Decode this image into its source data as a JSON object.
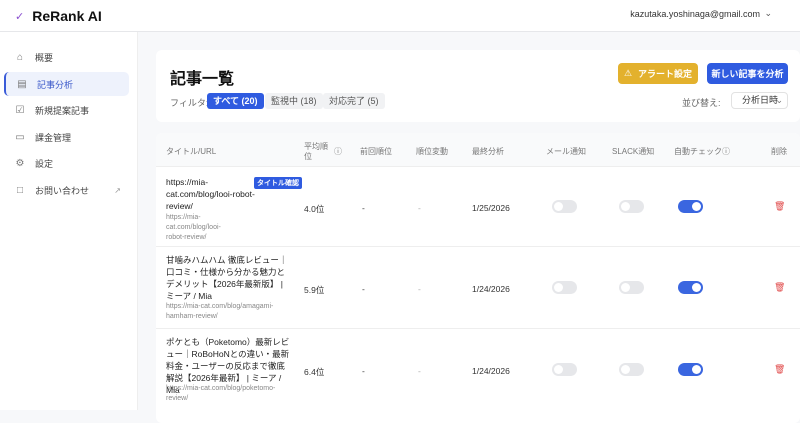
{
  "header": {
    "app_name": "ReRank AI",
    "user_email": "kazutaka.yoshinaga@gmail.com"
  },
  "sidebar": {
    "items": [
      {
        "label": "概要",
        "icon": "home-icon"
      },
      {
        "label": "記事分析",
        "icon": "document-icon",
        "active": true
      },
      {
        "label": "新規提案記事",
        "icon": "clipboard-icon"
      },
      {
        "label": "課金管理",
        "icon": "credit-card-icon"
      },
      {
        "label": "設定",
        "icon": "gear-icon"
      },
      {
        "label": "お問い合わせ",
        "icon": "chat-icon",
        "external": true
      }
    ]
  },
  "page": {
    "title": "記事一覧",
    "filter_label": "フィルタ:",
    "filters": [
      {
        "label": "すべて (20)",
        "active": true
      },
      {
        "label": "監視中 (18)"
      },
      {
        "label": "対応完了 (5)"
      }
    ],
    "alert_button": "アラート設定",
    "new_button": "新しい記事を分析",
    "sort_label": "並び替え:",
    "sort_value": "分析日時"
  },
  "table": {
    "headers": {
      "title": "タイトル/URL",
      "avg_rank": "平均順",
      "avg_rank2": "位",
      "prev": "前回順位",
      "change": "順位変動",
      "last": "最終分析",
      "mail": "メール通知",
      "slack": "SLACK通知",
      "auto": "自動チェック",
      "delete": "削除"
    },
    "rows": [
      {
        "title": "https://mia-cat.com/blog/looi-robot-review/",
        "badge": "タイトル確認",
        "url": "https://mia-cat.com/blog/looi-robot-review/",
        "avg": "4.0位",
        "prev": "-",
        "change": "-",
        "last": "1/25/2026",
        "mail": false,
        "slack": false,
        "auto": true
      },
      {
        "title": "甘噛みハムハム 徹底レビュー｜口コミ・仕様から分かる魅力とデメリット【2026年最新版】 | ミーア / Mia",
        "url": "https://mia-cat.com/blog/amagami-hamham-review/",
        "avg": "5.9位",
        "prev": "-",
        "change": "-",
        "last": "1/24/2026",
        "mail": false,
        "slack": false,
        "auto": true
      },
      {
        "title": "ポケとも（Poketomo）最新レビュー｜RoBoHoNとの違い・最新料金・ユーザーの反応まで徹底解説【2026年最新】 | ミーア / Mia",
        "url": "https://mia-cat.com/blog/poketomo-review/",
        "avg": "6.4位",
        "prev": "-",
        "change": "-",
        "last": "1/24/2026",
        "mail": false,
        "slack": false,
        "auto": true
      }
    ]
  }
}
